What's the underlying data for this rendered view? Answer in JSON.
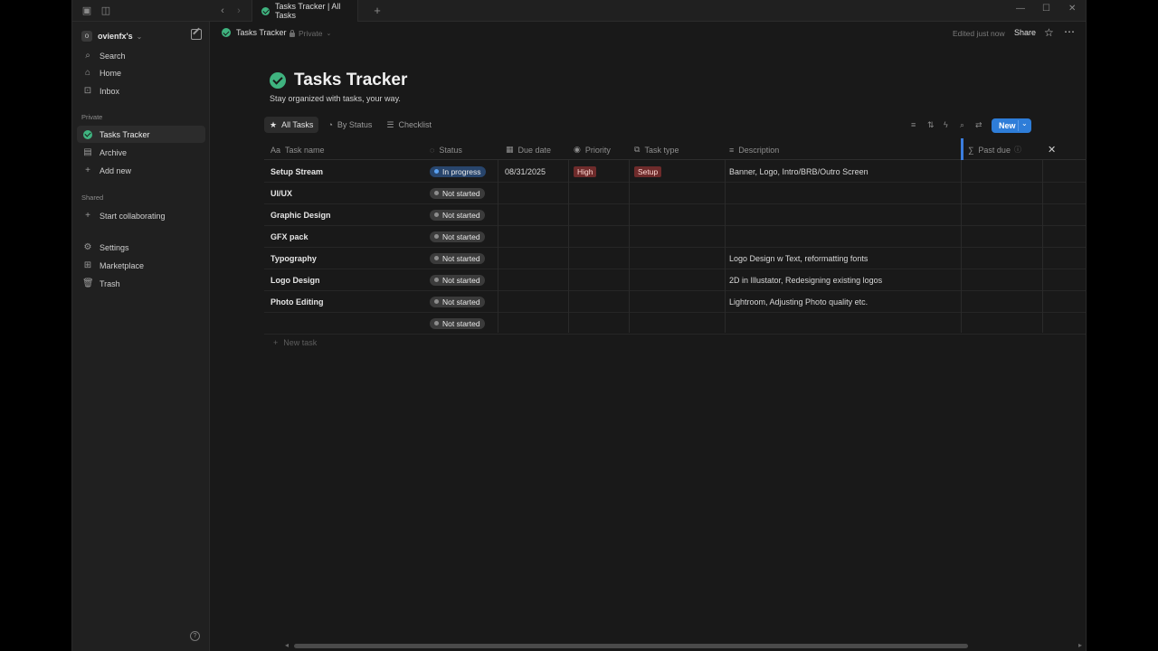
{
  "tab": {
    "title": "Tasks Tracker | All Tasks"
  },
  "workspace": {
    "name": "ovienfx's",
    "avatar": "o"
  },
  "sidebar": {
    "top_items": [
      {
        "label": "Search",
        "icon": "search-icon"
      },
      {
        "label": "Home",
        "icon": "home-icon"
      },
      {
        "label": "Inbox",
        "icon": "inbox-icon"
      }
    ],
    "private_label": "Private",
    "private_items": [
      {
        "label": "Tasks Tracker",
        "icon": "check-circle-icon",
        "active": true
      },
      {
        "label": "Archive",
        "icon": "page-icon"
      },
      {
        "label": "Add new",
        "icon": "plus-icon"
      }
    ],
    "shared_label": "Shared",
    "shared_items": [
      {
        "label": "Start collaborating",
        "icon": "plus-icon"
      }
    ],
    "bottom_items": [
      {
        "label": "Settings",
        "icon": "gear-icon"
      },
      {
        "label": "Marketplace",
        "icon": "marketplace-icon"
      },
      {
        "label": "Trash",
        "icon": "trash-icon"
      }
    ],
    "help": "?"
  },
  "topbar": {
    "breadcrumb": "Tasks Tracker",
    "privacy": "Private",
    "edited": "Edited just now",
    "share": "Share"
  },
  "page": {
    "title": "Tasks Tracker",
    "subtitle": "Stay organized with tasks, your way."
  },
  "views": [
    {
      "label": "All Tasks",
      "icon": "star-icon",
      "active": true
    },
    {
      "label": "By Status",
      "icon": "status-icon"
    },
    {
      "label": "Checklist",
      "icon": "checklist-icon"
    }
  ],
  "new_button": "New",
  "columns": [
    {
      "label": "Task name",
      "icon": "Aa"
    },
    {
      "label": "Status",
      "icon": "status-icon"
    },
    {
      "label": "Due date",
      "icon": "calendar-icon"
    },
    {
      "label": "Priority",
      "icon": "priority-icon"
    },
    {
      "label": "Task type",
      "icon": "tag-icon"
    },
    {
      "label": "Description",
      "icon": "text-icon"
    },
    {
      "label": "Past due",
      "icon": "formula-icon"
    }
  ],
  "rows": [
    {
      "name": "Setup Stream",
      "status": "In progress",
      "due": "08/31/2025",
      "priority": "High",
      "type": "Setup",
      "description": "Banner, Logo, Intro/BRB/Outro Screen"
    },
    {
      "name": "UI/UX",
      "status": "Not started",
      "due": "",
      "priority": "",
      "type": "",
      "description": ""
    },
    {
      "name": "Graphic Design",
      "status": "Not started",
      "due": "",
      "priority": "",
      "type": "",
      "description": ""
    },
    {
      "name": "GFX pack",
      "status": "Not started",
      "due": "",
      "priority": "",
      "type": "",
      "description": ""
    },
    {
      "name": "Typography",
      "status": "Not started",
      "due": "",
      "priority": "",
      "type": "",
      "description": "Logo Design w Text, reformatting fonts"
    },
    {
      "name": "Logo Design",
      "status": "Not started",
      "due": "",
      "priority": "",
      "type": "",
      "description": "2D in Illustator, Redesigning existing logos"
    },
    {
      "name": "Photo Editing",
      "status": "Not started",
      "due": "",
      "priority": "",
      "type": "",
      "description": "Lightroom, Adjusting Photo quality etc."
    },
    {
      "name": "",
      "status": "Not started",
      "due": "",
      "priority": "",
      "type": "",
      "description": ""
    }
  ],
  "new_task": "New task",
  "colors": {
    "accent": "#2e7dd8",
    "check": "#3fb37f",
    "in_progress": "#28456c",
    "high": "#6e2b2b"
  }
}
